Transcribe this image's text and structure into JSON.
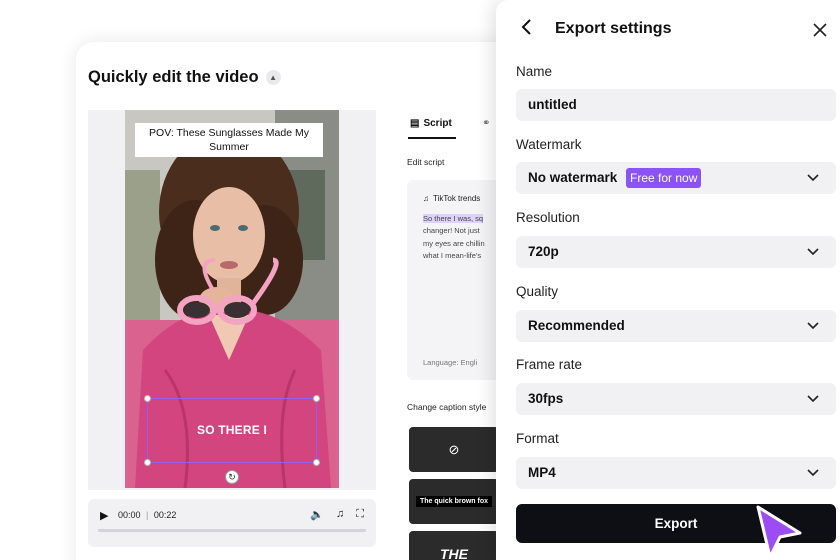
{
  "editor": {
    "title": "Quickly edit the video",
    "video_title_caption": "POV: These Sunglasses Made My Summer",
    "video_caption": "SO THERE I",
    "player": {
      "current_time": "00:00",
      "separator": "|",
      "total_time": "00:22"
    },
    "tabs": {
      "script": "Script"
    },
    "edit_script_label": "Edit script",
    "script_card": {
      "source": "TikTok trends",
      "highlight": "So there I was, sq",
      "text": "changer! Not just\nmy eyes are chillin\nwhat I mean-life's",
      "language": "Language:  Engli"
    },
    "caption_style_label": "Change caption style",
    "caption_style_sample_1": "The quick brown fox",
    "caption_style_sample_2": "THE"
  },
  "export_panel": {
    "title": "Export settings",
    "name": {
      "label": "Name",
      "value": "untitled"
    },
    "watermark": {
      "label": "Watermark",
      "value": "No watermark",
      "badge": "Free for now"
    },
    "resolution": {
      "label": "Resolution",
      "value": "720p"
    },
    "quality": {
      "label": "Quality",
      "value": "Recommended"
    },
    "frame_rate": {
      "label": "Frame rate",
      "value": "30fps"
    },
    "format": {
      "label": "Format",
      "value": "MP4"
    },
    "export_button": "Export"
  },
  "colors": {
    "accent_purple": "#8b53f7",
    "export_button_bg": "#0e0f14",
    "video_bg_pink": "#d9628f",
    "field_bg": "#f1f1f3"
  },
  "icons": [
    "back-arrow-icon",
    "close-icon",
    "chevron-down-icon",
    "play-icon",
    "volume-icon",
    "tiktok-icon",
    "fullscreen-icon",
    "ban-icon",
    "graduation-cap-icon",
    "script-icon",
    "rotate-icon",
    "cursor-icon"
  ]
}
